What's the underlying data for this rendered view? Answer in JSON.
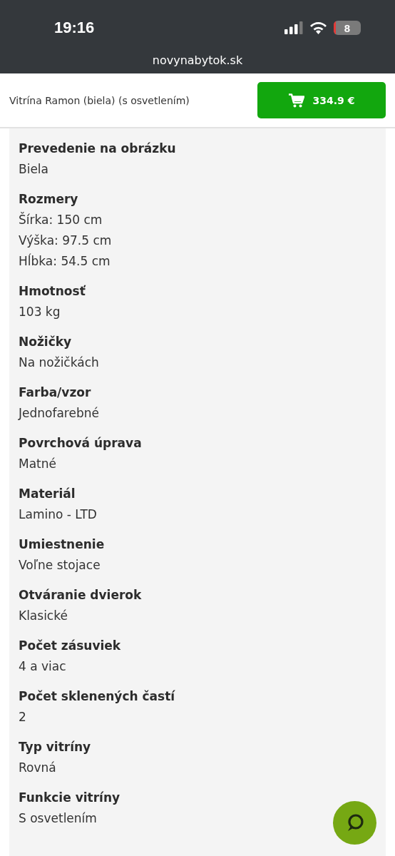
{
  "status_bar": {
    "time": "19:16",
    "battery": "8"
  },
  "browser": {
    "address": "novynabytok.sk"
  },
  "header": {
    "product_title": "Vitrína Ramon (biela) (s osvetlením)",
    "price_button": "334.9 €"
  },
  "parameters": [
    {
      "label": "Prevedenie na obrázku",
      "values": [
        "Biela"
      ]
    },
    {
      "label": "Rozmery",
      "values": [
        "Šírka: 150 cm",
        "Výška: 97.5 cm",
        "Hĺbka: 54.5 cm"
      ]
    },
    {
      "label": "Hmotnosť",
      "values": [
        "103 kg"
      ]
    },
    {
      "label": "Nožičky",
      "values": [
        "Na nožičkách"
      ]
    },
    {
      "label": "Farba/vzor",
      "values": [
        "Jednofarebné"
      ]
    },
    {
      "label": "Povrchová úprava",
      "values": [
        "Matné"
      ]
    },
    {
      "label": "Materiál",
      "values": [
        "Lamino - LTD"
      ]
    },
    {
      "label": "Umiestnenie",
      "values": [
        "Voľne stojace"
      ]
    },
    {
      "label": "Otváranie dvierok",
      "values": [
        "Klasické"
      ]
    },
    {
      "label": "Počet zásuviek",
      "values": [
        "4 a viac"
      ]
    },
    {
      "label": "Počet sklenených častí",
      "values": [
        "2"
      ]
    },
    {
      "label": "Typ vitríny",
      "values": [
        "Rovná"
      ]
    },
    {
      "label": "Funkcie vitríny",
      "values": [
        "S osvetlením"
      ]
    }
  ]
}
